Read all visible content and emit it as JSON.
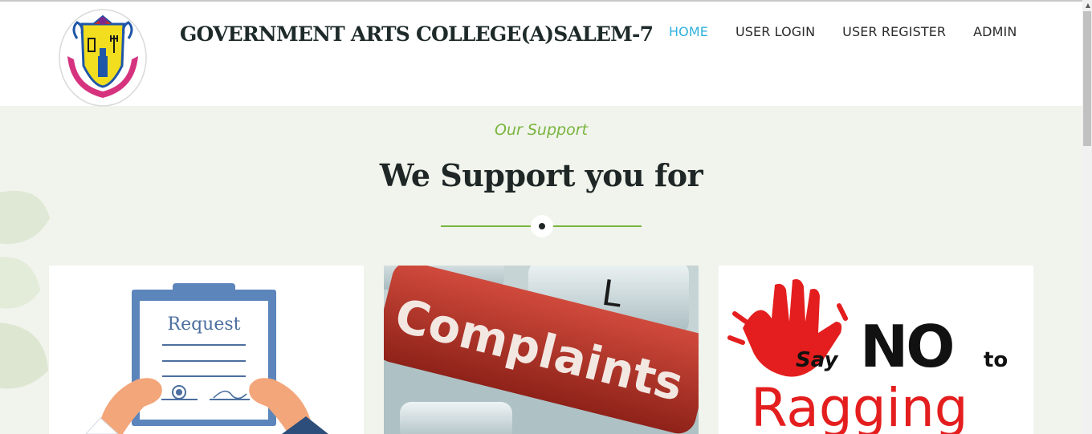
{
  "header": {
    "college_name": "GOVERNMENT ARTS COLLEGE(A)SALEM-7",
    "logo_icon": "college-emblem-icon"
  },
  "nav": {
    "items": [
      {
        "label": "HOME",
        "active": true
      },
      {
        "label": "USER LOGIN",
        "active": false
      },
      {
        "label": "USER REGISTER",
        "active": false
      },
      {
        "label": "ADMIN",
        "active": false
      }
    ]
  },
  "support": {
    "kicker": "Our Support",
    "title": "We Support you for"
  },
  "cards": [
    {
      "image_text": "Request",
      "icon": "request-clipboard-icon"
    },
    {
      "image_text": "Complaints",
      "key_letter": "L",
      "icon": "complaints-keyboard-icon"
    },
    {
      "image_text_say": "Say",
      "image_text_no": "NO",
      "image_text_to": "to",
      "image_text_ragging": "Ragging",
      "icon": "red-hand-icon"
    }
  ],
  "colors": {
    "accent_green": "#7ab43e",
    "active_nav": "#2fb1dc",
    "heading": "#1f2626",
    "page_bg": "#f0f4ec",
    "complaints_red": "#b83a2e",
    "ragging_red": "#e41e1e"
  }
}
